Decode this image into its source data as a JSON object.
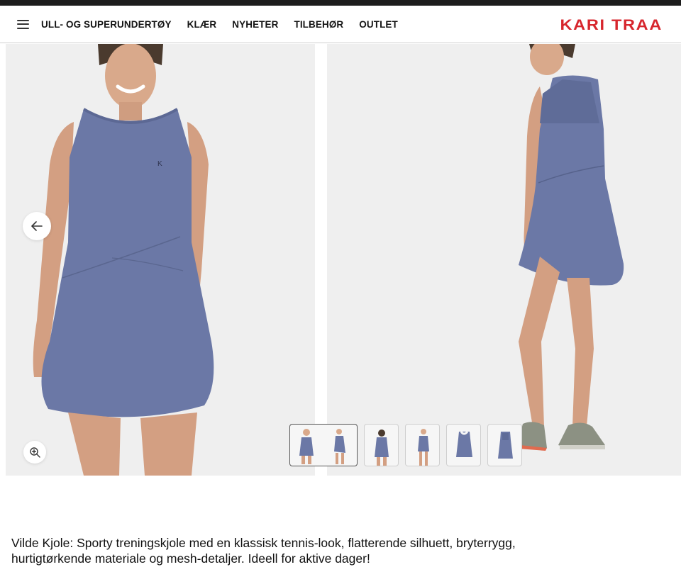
{
  "header": {
    "nav_items": [
      "ULL- OG SUPERUNDERTØY",
      "KLÆR",
      "NYHETER",
      "TILBEHØR",
      "OUTLET"
    ],
    "logo_text": "KARI TRAA"
  },
  "gallery": {
    "thumbnail_count": 6,
    "selected_thumbnail_index": 0
  },
  "product": {
    "description": "Vilde Kjole: Sporty treningskjole med en klassisk tennis-look, flatterende silhuett, bryterrygg, hurtigtørkende materiale og mesh-detaljer. Ideell for aktive dager!"
  },
  "colors": {
    "brand_red": "#d7262d",
    "dress_blue": "#6b78a6",
    "image_background": "#efefef"
  },
  "icons": {
    "menu": "hamburger-menu-icon",
    "prev": "arrow-left-icon",
    "zoom": "zoom-in-icon"
  }
}
